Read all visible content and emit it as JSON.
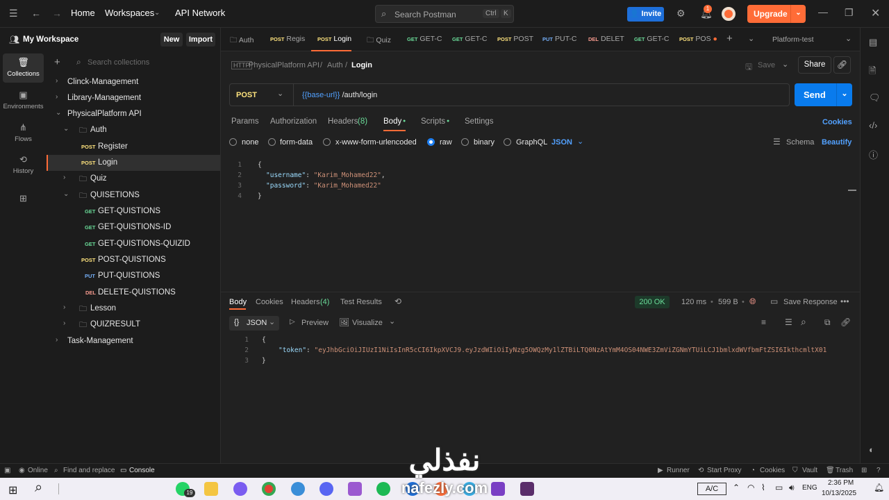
{
  "topbar": {
    "home": "Home",
    "workspaces": "Workspaces",
    "api_network": "API Network",
    "search_placeholder": "Search Postman",
    "kbd_ctrl": "Ctrl",
    "kbd_k": "K",
    "invite": "Invite",
    "notif_count": "1",
    "upgrade": "Upgrade"
  },
  "sidebar": {
    "workspace_name": "My Workspace",
    "new_btn": "New",
    "import_btn": "Import",
    "search_placeholder": "Search collections",
    "rail": [
      {
        "label": "Collections"
      },
      {
        "label": "Environments"
      },
      {
        "label": "Flows"
      },
      {
        "label": "History"
      }
    ],
    "tree": [
      {
        "label": "Clinck-Management"
      },
      {
        "label": "Library-Management"
      },
      {
        "label": "PhysicalPlatform API"
      },
      {
        "label": "Auth"
      },
      {
        "method": "POST",
        "label": "Register"
      },
      {
        "method": "POST",
        "label": "Login"
      },
      {
        "label": "Quiz"
      },
      {
        "label": "QUISETIONS"
      },
      {
        "method": "GET",
        "label": "GET-QUISTIONS"
      },
      {
        "method": "GET",
        "label": "GET-QUISTIONS-ID"
      },
      {
        "method": "GET",
        "label": "GET-QUISTIONS-QUIZID"
      },
      {
        "method": "POST",
        "label": "POST-QUISTIONS"
      },
      {
        "method": "PUT",
        "label": "PUT-QUISTIONS"
      },
      {
        "method": "DEL",
        "label": "DELETE-QUISTIONS"
      },
      {
        "label": "Lesson"
      },
      {
        "label": "QUIZRESULT"
      },
      {
        "label": "Task-Management"
      }
    ]
  },
  "tabs": [
    {
      "method": "",
      "label": "Auth"
    },
    {
      "method": "POST",
      "label": "Regis"
    },
    {
      "method": "POST",
      "label": "Login"
    },
    {
      "method": "",
      "label": "Quiz"
    },
    {
      "method": "GET",
      "label": "GET-C"
    },
    {
      "method": "GET",
      "label": "GET-C"
    },
    {
      "method": "POST",
      "label": "POST"
    },
    {
      "method": "PUT",
      "label": "PUT-C"
    },
    {
      "method": "DEL",
      "label": "DELET"
    },
    {
      "method": "GET",
      "label": "GET-C"
    },
    {
      "method": "POST",
      "label": "POS"
    }
  ],
  "environment": "Platform-test",
  "request": {
    "breadcrumb_root": "PhysicalPlatform API",
    "breadcrumb_folder": "Auth",
    "breadcrumb_current": "Login",
    "save": "Save",
    "share": "Share",
    "method": "POST",
    "url_var": "{{base-url}}",
    "url_path": " /auth/login",
    "send": "Send",
    "tabs": [
      "Params",
      "Authorization",
      "Headers",
      "(8)",
      "Body",
      "Scripts",
      "Settings"
    ],
    "cookies": "Cookies",
    "body_modes": [
      "none",
      "form-data",
      "x-www-form-urlencoded",
      "raw",
      "binary",
      "GraphQL"
    ],
    "body_format": "JSON",
    "schema": "Schema",
    "beautify": "Beautify",
    "body_lines": [
      {
        "n": "1",
        "text": "{"
      },
      {
        "n": "2",
        "key": "\"username\"",
        "sep": ": ",
        "val": "\"Karim_Mohamed22\"",
        "end": ","
      },
      {
        "n": "3",
        "key": "\"password\"",
        "sep": ": ",
        "val": "\"Karim_Mohamed22\"",
        "end": ""
      },
      {
        "n": "4",
        "text": "}"
      }
    ]
  },
  "response": {
    "tabs": [
      "Body",
      "Cookies",
      "Headers",
      "(4)",
      "Test Results"
    ],
    "status": "200 OK",
    "time": "120 ms",
    "size": "599 B",
    "save_response": "Save Response",
    "format": "JSON",
    "preview": "Preview",
    "visualize": "Visualize",
    "lines": [
      {
        "n": "1",
        "text": "{"
      },
      {
        "n": "2",
        "key": "\"token\"",
        "sep": ": ",
        "val": "\"eyJhbGciOiJIUzI1NiIsInR5cCI6IkpXVCJ9.eyJzdWIiOiIyNzg5OWQzMy1lZTBiLTQ0NzAtYmM4OS04NWE3ZmViZGNmYTUiLCJ1bmlxdWVfbmFtZSI6IkthcmltX01"
      },
      {
        "n": "3",
        "text": "}"
      }
    ]
  },
  "statusbar": {
    "online": "Online",
    "find_replace": "Find and replace",
    "console": "Console",
    "runner": "Runner",
    "start_proxy": "Start Proxy",
    "cookies": "Cookies",
    "vault": "Vault",
    "trash": "Trash"
  },
  "taskbar": {
    "whatsapp_badge": "19",
    "keyboard_label": "A/C",
    "lang": "ENG",
    "time": "2:36 PM",
    "date": "10/13/2025"
  },
  "watermark": {
    "arabic": "نفذلي",
    "latin": "nafezly.com"
  },
  "colors": {
    "accent": "#ff6c37",
    "send": "#097bed",
    "get": "#6bdd9a",
    "post": "#ffe47e",
    "put": "#74aef6",
    "delete": "#f79a8e"
  }
}
